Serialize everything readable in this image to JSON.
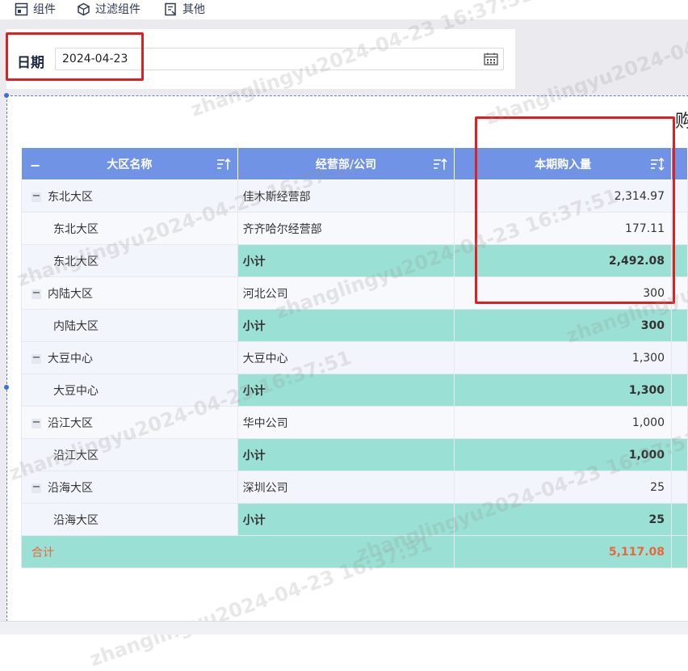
{
  "toolbar": {
    "items": [
      {
        "label": "组件",
        "icon": "component-icon"
      },
      {
        "label": "过滤组件",
        "icon": "filter-cube-icon"
      },
      {
        "label": "其他",
        "icon": "other-doc-icon"
      }
    ]
  },
  "filter": {
    "date_label": "日期",
    "date_value": "2024-04-23",
    "calendar_icon": "calendar-icon"
  },
  "report": {
    "title_fragment": "购",
    "columns": [
      "大区名称",
      "经营部/公司",
      "本期购入量"
    ],
    "rows": [
      {
        "type": "group",
        "region": "东北大区",
        "dept": "佳木斯经营部",
        "qty": "2,314.97"
      },
      {
        "type": "detail",
        "region": "东北大区",
        "dept": "齐齐哈尔经营部",
        "qty": "177.11"
      },
      {
        "type": "subtotal",
        "region": "东北大区",
        "dept": "小计",
        "qty": "2,492.08"
      },
      {
        "type": "group",
        "region": "内陆大区",
        "dept": "河北公司",
        "qty": "300"
      },
      {
        "type": "subtotal",
        "region": "内陆大区",
        "dept": "小计",
        "qty": "300"
      },
      {
        "type": "group",
        "region": "大豆中心",
        "dept": "大豆中心",
        "qty": "1,300"
      },
      {
        "type": "subtotal",
        "region": "大豆中心",
        "dept": "小计",
        "qty": "1,300"
      },
      {
        "type": "group",
        "region": "沿江大区",
        "dept": "华中公司",
        "qty": "1,000"
      },
      {
        "type": "subtotal",
        "region": "沿江大区",
        "dept": "小计",
        "qty": "1,000"
      },
      {
        "type": "group",
        "region": "沿海大区",
        "dept": "深圳公司",
        "qty": "25"
      },
      {
        "type": "subtotal",
        "region": "沿海大区",
        "dept": "小计",
        "qty": "25"
      }
    ],
    "total": {
      "label": "合计",
      "qty": "5,117.08"
    }
  },
  "watermark": {
    "texts": [
      "zhanglingyu2024-04-23 16:37:51"
    ]
  },
  "colors": {
    "header_bg": "#7093e6",
    "subtotal_bg": "#9ae0d4",
    "total_text": "#e8683a",
    "highlight_box": "#e02020"
  }
}
